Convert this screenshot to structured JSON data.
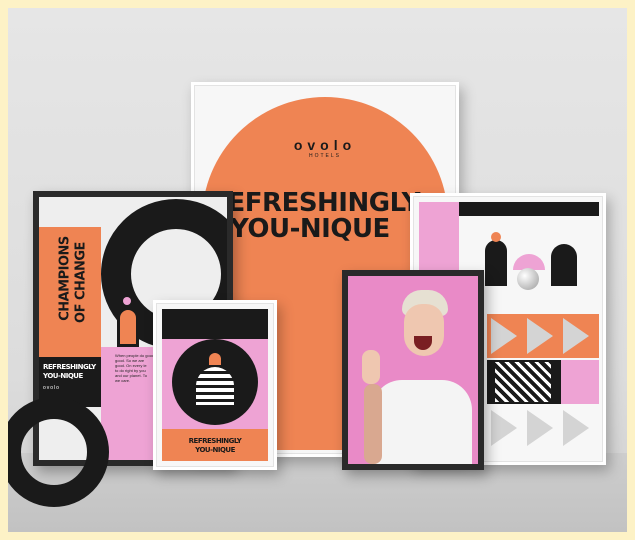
{
  "brand": {
    "name": "ovolo",
    "subname": "HOTELS"
  },
  "big_poster": {
    "line1": "REFRESHINGLY",
    "line2": "YOU-NIQUE"
  },
  "left_poster": {
    "vertical_title_1": "CHAMPIONS",
    "vertical_title_2": "OF CHANGE",
    "tagline_1": "REFRESHINGLY",
    "tagline_2": "YOU-NIQUE",
    "logo": "ovolo",
    "body_lines": [
      "When people do good",
      "good. So we are",
      "good. On every le",
      "to do right by you",
      "and our planet. To",
      "we care."
    ]
  },
  "small_poster": {
    "line1": "REFRESHINGLY",
    "line2": "YOU-NIQUE"
  },
  "colors": {
    "orange": "#ef8453",
    "pink": "#eea3d4",
    "black": "#1a1a1a",
    "grey": "#d9d9d9"
  }
}
